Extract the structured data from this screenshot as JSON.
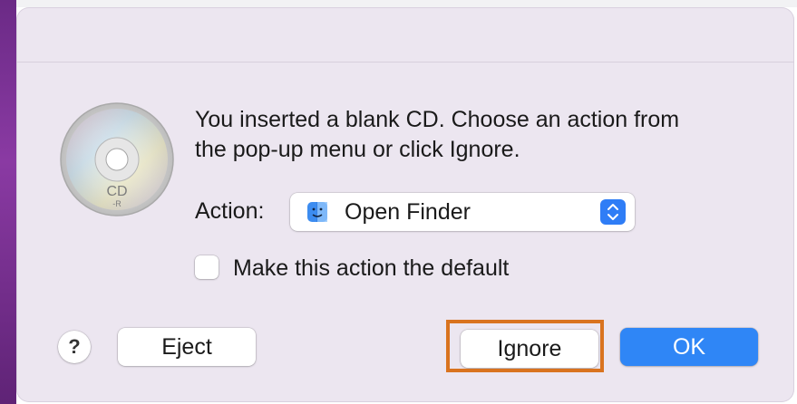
{
  "dialog": {
    "message_line1": "You inserted a blank CD. Choose an action from",
    "message_line2": "the pop-up menu or click Ignore.",
    "action_label": "Action:",
    "action_selected": "Open Finder",
    "checkbox_label": "Make this action the default",
    "checkbox_checked": false,
    "cd_label_main": "CD",
    "cd_label_sub": "-R"
  },
  "buttons": {
    "help": "?",
    "eject": "Eject",
    "ignore": "Ignore",
    "ok": "OK"
  },
  "colors": {
    "accent": "#2f86f6",
    "highlight": "#d9731f",
    "dialog_background": "#ece6f0"
  },
  "icons": {
    "disc": "cd-r-disc-icon",
    "finder": "finder-icon",
    "popup": "updown-chevron-icon"
  }
}
